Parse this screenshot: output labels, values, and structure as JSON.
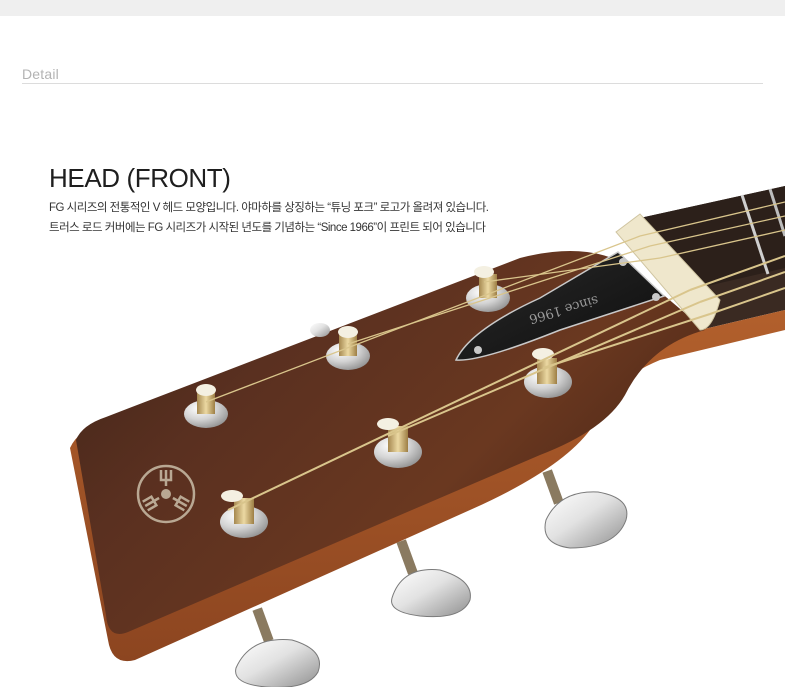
{
  "section": {
    "label": "Detail"
  },
  "head": {
    "title": "HEAD (FRONT)",
    "description_lines": [
      "FG 시리즈의 전통적인 V 헤드 모양입니다. 야마하를 상징하는 “튜닝 포크” 로고가 올려져 있습니다.",
      "트러스 로드 커버에는 FG 시리즈가 시작된 년도를 기념하는 “Since 1966”이 프린트 되어 있습니다"
    ]
  },
  "product_image": {
    "truss_rod_text": "since 1966",
    "logo_icon": "yamaha-tuning-fork-logo",
    "colors": {
      "headstock": "#5a2e1a",
      "headstock_edge": "#a4582b",
      "nut": "#f1ead2",
      "chrome": "#d8d8d8",
      "string": "#d9c58c"
    }
  }
}
